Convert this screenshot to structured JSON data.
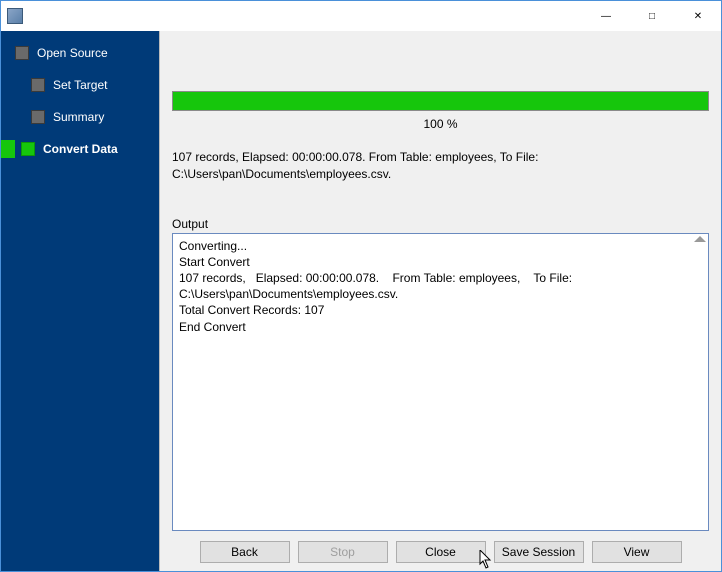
{
  "sidebar": {
    "items": [
      {
        "label": "Open Source"
      },
      {
        "label": "Set Target"
      },
      {
        "label": "Summary"
      },
      {
        "label": "Convert Data"
      }
    ]
  },
  "progress": {
    "percent_label": "100 %"
  },
  "status": {
    "line1": "107 records,    Elapsed: 00:00:00.078.    From Table: employees,    To File:",
    "line2": "C:\\Users\\pan\\Documents\\employees.csv."
  },
  "output": {
    "label": "Output",
    "text": "Converting...\nStart Convert\n107 records,   Elapsed: 00:00:00.078.    From Table: employees,    To File: C:\\Users\\pan\\Documents\\employees.csv.\nTotal Convert Records: 107\nEnd Convert"
  },
  "buttons": {
    "back": "Back",
    "stop": "Stop",
    "close": "Close",
    "save_session": "Save Session",
    "view": "View"
  }
}
